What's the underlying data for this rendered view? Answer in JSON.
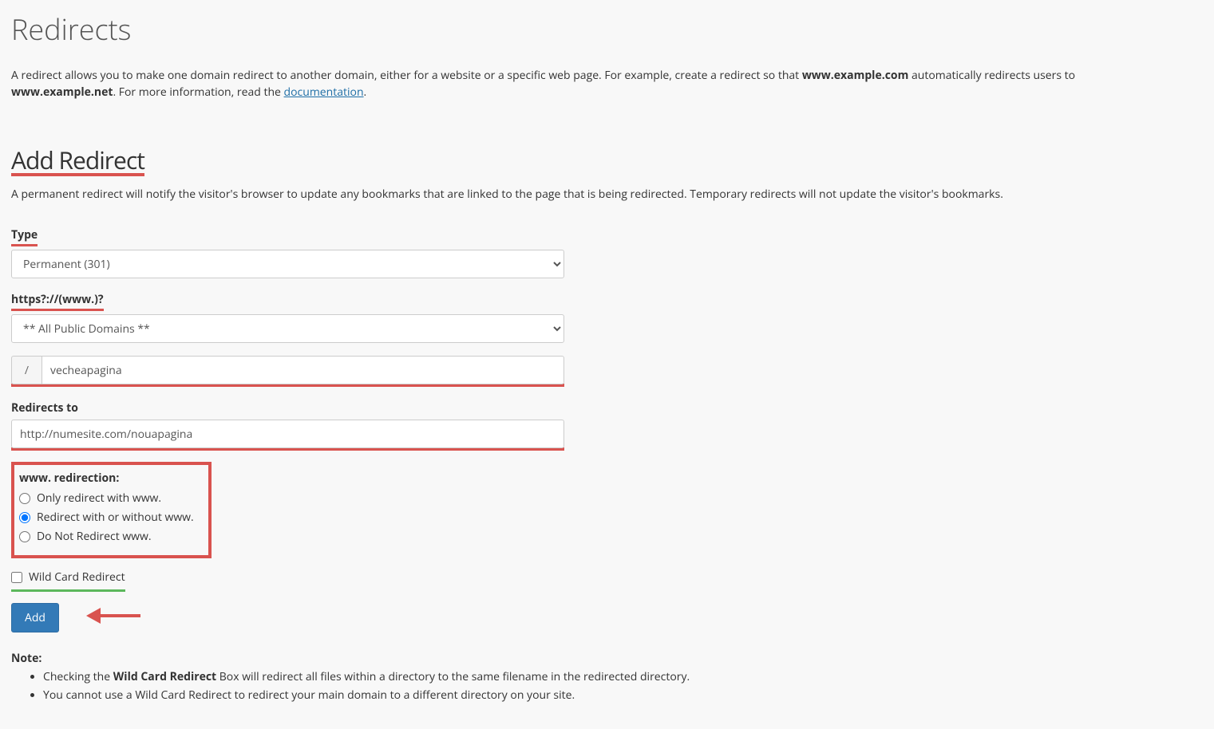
{
  "page_title": "Redirects",
  "intro_1": "A redirect allows you to make one domain redirect to another domain, either for a website or a specific web page. For example, create a redirect so that ",
  "intro_strong1": "www.example.com",
  "intro_2": " automatically redirects users to ",
  "intro_strong2": "www.example.net",
  "intro_3": ". For more information, read the ",
  "intro_link": "documentation",
  "intro_4": ".",
  "section_title": "Add Redirect",
  "section_desc": "A permanent redirect will notify the visitor's browser to update any bookmarks that are linked to the page that is being redirected. Temporary redirects will not update the visitor's bookmarks.",
  "type_label": "Type",
  "type_value": "Permanent (301)",
  "domain_label": "https?://(www.)?",
  "domain_value": "** All Public Domains **",
  "path_prefix": "/",
  "path_value": "vecheapagina",
  "redirects_to_label": "Redirects to",
  "redirects_to_value": "http://numesite.com/nouapagina",
  "www_title": "www. redirection:",
  "www_opt1": "Only redirect with www.",
  "www_opt2": "Redirect with or without www.",
  "www_opt3": "Do Not Redirect www.",
  "wildcard_label": "Wild Card Redirect",
  "add_button": "Add",
  "note_title": "Note:",
  "note_1a": "Checking the ",
  "note_1b": "Wild Card Redirect",
  "note_1c": " Box will redirect all files within a directory to the same filename in the redirected directory.",
  "note_2": "You cannot use a Wild Card Redirect to redirect your main domain to a different directory on your site."
}
